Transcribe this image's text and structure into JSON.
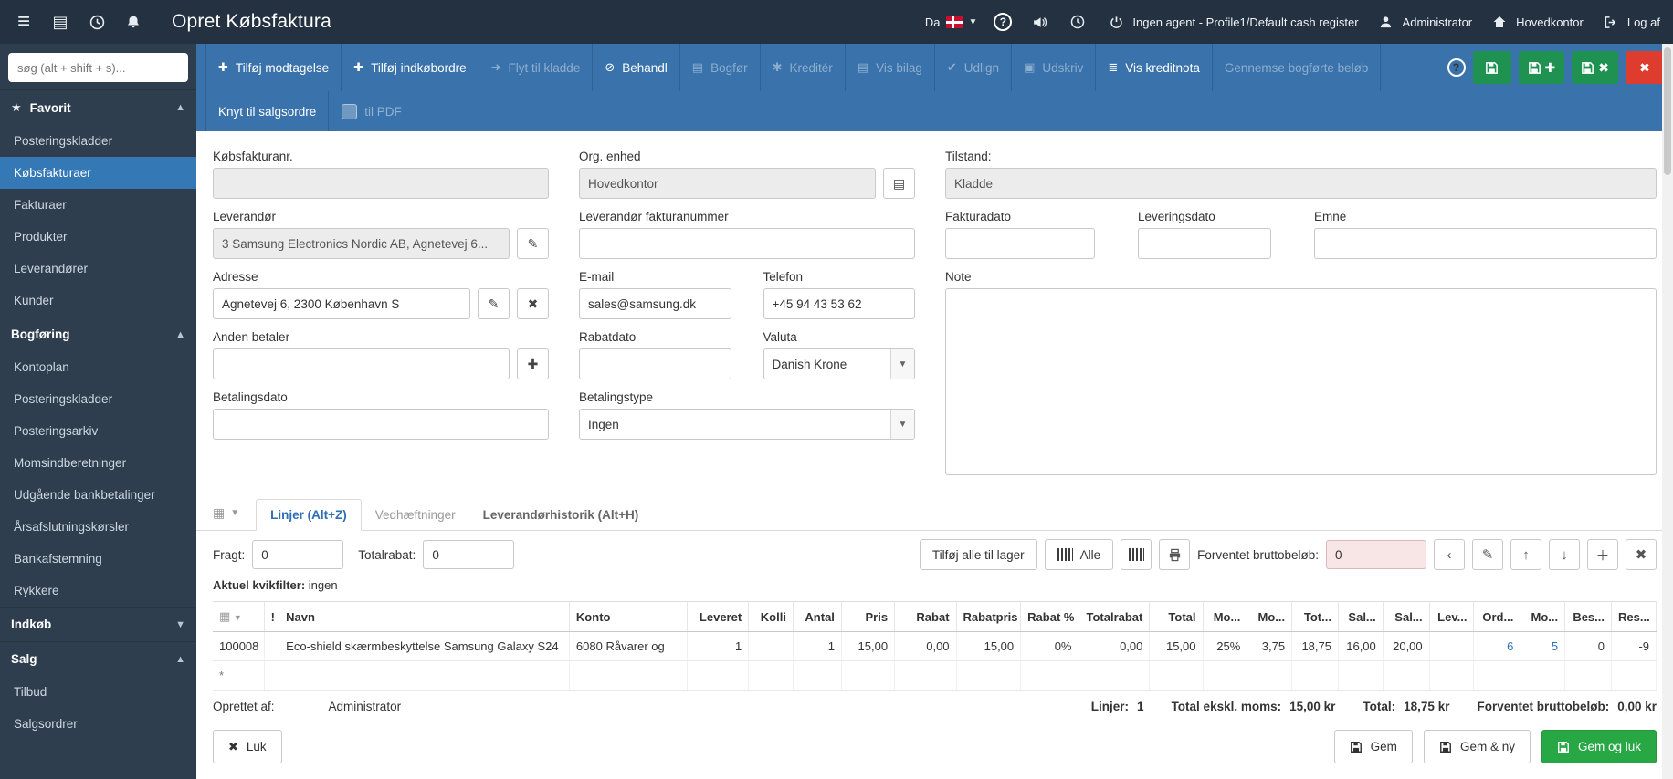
{
  "colors": {
    "topbar_bg": "#233140",
    "sidebar_bg": "#2e3e4e",
    "selected_item_bg": "#3478b6",
    "toolbar_bg": "#3a72ab",
    "save_green": "#1f9151",
    "danger_red": "#dd3c2e",
    "confirm_green": "#28a745",
    "link_blue": "#2f6db4",
    "warning_input_bg": "#f8e5e5"
  },
  "topbar": {
    "title": "Opret Købsfaktura",
    "language_label": "Da",
    "agent_label": "Ingen agent - Profile1/Default cash register",
    "user_label": "Administrator",
    "location_label": "Hovedkontor",
    "logout_label": "Log af"
  },
  "sidebar": {
    "search_placeholder": "søg (alt + shift + s)...",
    "favorit": {
      "title": "Favorit",
      "items": [
        "Posteringskladder",
        "Købsfakturaer",
        "Fakturaer",
        "Produkter",
        "Leverandører",
        "Kunder"
      ]
    },
    "bogfoering": {
      "title": "Bogføring",
      "items": [
        "Kontoplan",
        "Posteringskladder",
        "Posteringsarkiv",
        "Momsindberetninger",
        "Udgående bankbetalinger",
        "Årsafslutningskørsler",
        "Bankafstemning",
        "Rykkere"
      ]
    },
    "indkoeb": {
      "title": "Indkøb"
    },
    "salg": {
      "title": "Salg",
      "items": [
        "Tilbud",
        "Salgsordrer"
      ]
    }
  },
  "toolbar": {
    "buttons": [
      "Tilføj modtagelse",
      "Tilføj indkøbordre",
      "Flyt til kladde",
      "Behandl",
      "Bogfør",
      "Kreditér",
      "Vis bilag",
      "Udlign",
      "Udskriv",
      "Vis kreditnota",
      "Gennemse bogførte beløb"
    ],
    "row2": {
      "knyt_label": "Knyt til salgsordre",
      "pdf_label": "til PDF"
    }
  },
  "form": {
    "koebsfakturanr": {
      "label": "Købsfakturanr.",
      "value": ""
    },
    "org_enhed": {
      "label": "Org. enhed",
      "value": "Hovedkontor"
    },
    "tilstand": {
      "label": "Tilstand:",
      "value": "Kladde"
    },
    "leverandoer": {
      "label": "Leverandør",
      "value": "3 Samsung Electronics Nordic AB, Agnetevej 6..."
    },
    "lev_fakturanummer": {
      "label": "Leverandør fakturanummer",
      "value": ""
    },
    "fakturadato": {
      "label": "Fakturadato",
      "value": ""
    },
    "leveringsdato": {
      "label": "Leveringsdato",
      "value": ""
    },
    "emne": {
      "label": "Emne",
      "value": ""
    },
    "adresse": {
      "label": "Adresse",
      "value": "Agnetevej 6, 2300 København S"
    },
    "email": {
      "label": "E-mail",
      "value": "sales@samsung.dk"
    },
    "telefon": {
      "label": "Telefon",
      "value": "+45 94 43 53 62"
    },
    "note": {
      "label": "Note",
      "value": ""
    },
    "anden_betaler": {
      "label": "Anden betaler",
      "value": ""
    },
    "rabatdato": {
      "label": "Rabatdato",
      "value": ""
    },
    "valuta": {
      "label": "Valuta",
      "value": "Danish Krone"
    },
    "betalingsdato": {
      "label": "Betalingsdato",
      "value": ""
    },
    "betalingstype": {
      "label": "Betalingstype",
      "value": "Ingen"
    }
  },
  "tabs": [
    "Linjer (Alt+Z)",
    "Vedhæftninger",
    "Leverandørhistorik (Alt+H)"
  ],
  "lines_bar": {
    "fragt_label": "Fragt:",
    "fragt_value": "0",
    "totalrabat_label": "Totalrabat:",
    "totalrabat_value": "0",
    "add_all_label": "Tilføj alle til lager",
    "alle_label": "Alle",
    "forventet_label": "Forventet bruttobeløb:",
    "forventet_value": "0"
  },
  "quickfilter": {
    "label": "Aktuel kvikfilter:",
    "value": "ingen"
  },
  "table": {
    "headers": [
      "",
      "!",
      "Navn",
      "Konto",
      "Leveret",
      "Kolli",
      "Antal",
      "Pris",
      "Rabat",
      "Rabatpris",
      "Rabat %",
      "Totalrabat",
      "Total",
      "Mo...",
      "Mo...",
      "Tot...",
      "Sal...",
      "Sal...",
      "Lev...",
      "Ord...",
      "Mo...",
      "Bes...",
      "Res..."
    ],
    "row": [
      "100008",
      "",
      "Eco-shield skærmbeskyttelse Samsung Galaxy S24",
      "6080 Råvarer og",
      "1",
      "",
      "1",
      "15,00",
      "0,00",
      "15,00",
      "0%",
      "0,00",
      "15,00",
      "25%",
      "3,75",
      "18,75",
      "16,00",
      "20,00",
      "",
      "6",
      "5",
      "0",
      "-9"
    ],
    "new_row_marker": "*"
  },
  "summary": {
    "oprettet_label": "Oprettet af:",
    "oprettet_value": "Administrator",
    "linjer_label": "Linjer:",
    "linjer_value": "1",
    "ekskl_label": "Total ekskl. moms:",
    "ekskl_value": "15,00 kr",
    "total_label": "Total:",
    "total_value": "18,75 kr",
    "forventet_label": "Forventet bruttobeløb:",
    "forventet_value": "0,00 kr"
  },
  "actions": {
    "luk": "Luk",
    "gem": "Gem",
    "gem_ny": "Gem & ny",
    "gem_og_luk": "Gem og luk"
  }
}
